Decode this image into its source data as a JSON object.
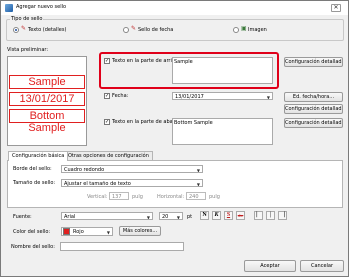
{
  "window": {
    "title": "Agregar nuevo sello",
    "close_glyph": "✕"
  },
  "stamp_type": {
    "legend": "Tipo de sello",
    "options": [
      {
        "label": "Texto (detalles)",
        "selected": true,
        "icon": "text-stamp-icon"
      },
      {
        "label": "Sello de fecha",
        "selected": false,
        "icon": "date-stamp-icon"
      },
      {
        "label": "Imagen",
        "selected": false,
        "icon": "image-stamp-icon"
      }
    ]
  },
  "preview": {
    "legend": "Vista preliminar:",
    "lines": [
      "Sample",
      "13/01/2017",
      "Bottom Sample"
    ],
    "stamp_color": "#e02020"
  },
  "top_text": {
    "checked": true,
    "label": "Texto en la parte de arriba:",
    "value": "Sample",
    "button": "Configuración detallada..."
  },
  "date": {
    "checked": true,
    "label": "Fecha:",
    "value": "13/01/2017",
    "button1": "Ed. fecha/hora...",
    "button2": "Configuración detallada..."
  },
  "bottom_text": {
    "checked": true,
    "label": "Texto en la parte de abajo:",
    "value": "Bottom Sample",
    "button": "Configuración detallada..."
  },
  "tabs": [
    "Configuración básica",
    "Otras opciones de configuración"
  ],
  "basic": {
    "border_label": "Borde del sello:",
    "border_value": "Cuadro redondo",
    "size_label": "Tamaño de sello:",
    "size_value": "Ajustar el tamaño de texto",
    "vertical_label": "Vertical:",
    "vertical_value": "137",
    "horizontal_label": "Horizontal:",
    "horizontal_value": "240",
    "unit": "pulg",
    "font_label": "Fuente:",
    "font_value": "Arial",
    "font_size": "20",
    "font_unit": "pt",
    "bold": "N",
    "italic": "K",
    "underline": "S",
    "strike": "abc",
    "color_label": "Color del sello:",
    "color_value": "Rojo",
    "more_colors": "Más colores..."
  },
  "stamp_name": {
    "label": "Nombre del sello:",
    "value": ""
  },
  "footer": {
    "ok": "Aceptar",
    "cancel": "Cancelar"
  }
}
